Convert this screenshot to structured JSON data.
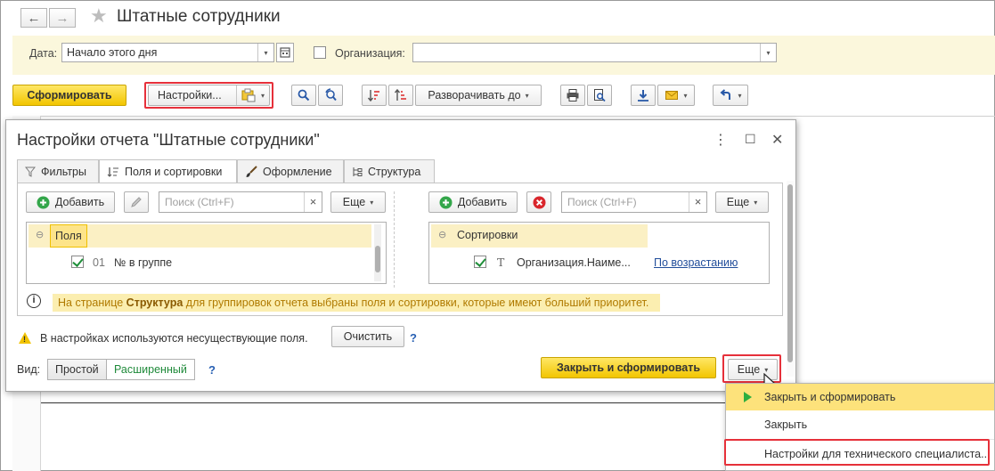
{
  "window": {
    "title": "Штатные сотрудники",
    "back_icon": "←",
    "forward_icon": "→",
    "favorite_icon": "★"
  },
  "filters": {
    "date_label": "Дата:",
    "date_value": "Начало этого дня",
    "organization_label": "Организация:",
    "organization_value": ""
  },
  "toolbar": {
    "generate_label": "Сформировать",
    "settings_label": "Настройки...",
    "expand_label": "Разворачивать до"
  },
  "dialog": {
    "title": "Настройки отчета \"Штатные сотрудники\"",
    "more_icon": "⋮",
    "maximize_icon": "☐",
    "close_icon": "✕",
    "tabs": [
      {
        "label": "Фильтры",
        "active": false
      },
      {
        "label": "Поля и сортировки",
        "active": true
      },
      {
        "label": "Оформление",
        "active": false
      },
      {
        "label": "Структура",
        "active": false
      }
    ],
    "fields_panel": {
      "add_label": "Добавить",
      "search_placeholder": "Поиск (Ctrl+F)",
      "more_label": "Еще",
      "root_label": "Поля",
      "rows": [
        {
          "checked": true,
          "code": "01",
          "name": "№ в группе"
        }
      ]
    },
    "sort_panel": {
      "add_label": "Добавить",
      "search_placeholder": "Поиск (Ctrl+F)",
      "more_label": "Еще",
      "root_label": "Сортировки",
      "rows": [
        {
          "checked": true,
          "type_icon": "Т",
          "name": "Организация.Наиме...",
          "direction": "По возрастанию"
        }
      ]
    },
    "info": {
      "before": "На странице ",
      "bold": "Структура",
      "after": " для группировок отчета выбраны поля и сортировки, которые имеют больший приоритет."
    },
    "warning": {
      "text": "В настройках используются несуществующие поля.",
      "clear_label": "Очистить",
      "help": "?"
    },
    "view": {
      "label": "Вид:",
      "simple_label": "Простой",
      "advanced_label": "Расширенный",
      "help": "?"
    },
    "close_generate_label": "Закрыть и сформировать",
    "more_label": "Еще"
  },
  "more_menu": {
    "items": [
      {
        "label": "Закрыть и сформировать",
        "highlighted": true
      },
      {
        "label": "Закрыть",
        "highlighted": false
      },
      {
        "label": "Настройки для технического специалиста...",
        "highlighted": false
      }
    ]
  },
  "colors": {
    "accent_yellow": "#f2c500",
    "highlight_box": "#e6303a",
    "filter_bar": "#fbf7dc",
    "menu_highlight": "#fde27b"
  }
}
